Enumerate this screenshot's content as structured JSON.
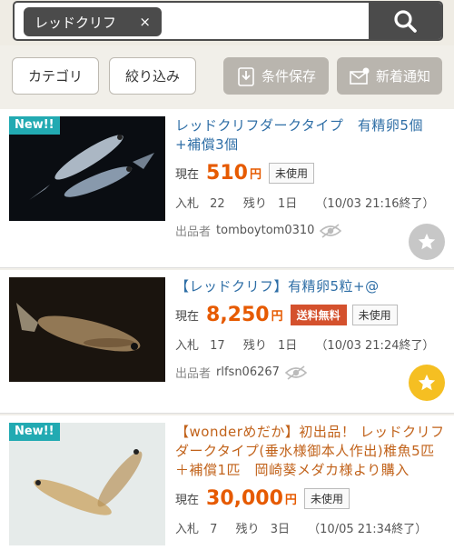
{
  "search": {
    "chip_label": "レッドクリフ",
    "chip_close": "×"
  },
  "toolbar": {
    "category_label": "カテゴリ",
    "filter_label": "絞り込み",
    "save_condition_label": "条件保存",
    "new_alert_label": "新着通知"
  },
  "items": [
    {
      "new_badge": "New!!",
      "title": "レッドクリフダークタイプ　有精卵5個+補償3個",
      "price_label": "現在",
      "price": "510",
      "currency": "円",
      "condition": "未使用",
      "bids_label": "入札",
      "bids": "22",
      "remaining_label": "残り",
      "remaining": "1日",
      "end": "（10/03 21:16終了）",
      "seller_label": "出品者",
      "seller": "tomboytom0310",
      "watched": false
    },
    {
      "title": "【レッドクリフ】有精卵5粒+@",
      "price_label": "現在",
      "price": "8,250",
      "currency": "円",
      "shipping": "送料無料",
      "condition": "未使用",
      "bids_label": "入札",
      "bids": "17",
      "remaining_label": "残り",
      "remaining": "1日",
      "end": "（10/03 21:24終了）",
      "seller_label": "出品者",
      "seller": "rlfsn06267",
      "watched": true
    },
    {
      "new_badge": "New!!",
      "title": "【wonderめだか】初出品！ レッドクリフダークタイプ(垂水様御本人作出)稚魚5匹＋補償1匹　岡崎葵メダカ様より購入",
      "price_label": "現在",
      "price": "30,000",
      "currency": "円",
      "condition": "未使用",
      "bids_label": "入札",
      "bids": "7",
      "remaining_label": "残り",
      "remaining": "3日",
      "end": "（10/05 21:34終了）"
    }
  ],
  "colors": {
    "accent_price": "#e65a00",
    "link_title": "#2e6ea6",
    "new_badge": "#22aab2",
    "free_shipping": "#d4512d",
    "watch_star_active": "#f5bf22"
  }
}
